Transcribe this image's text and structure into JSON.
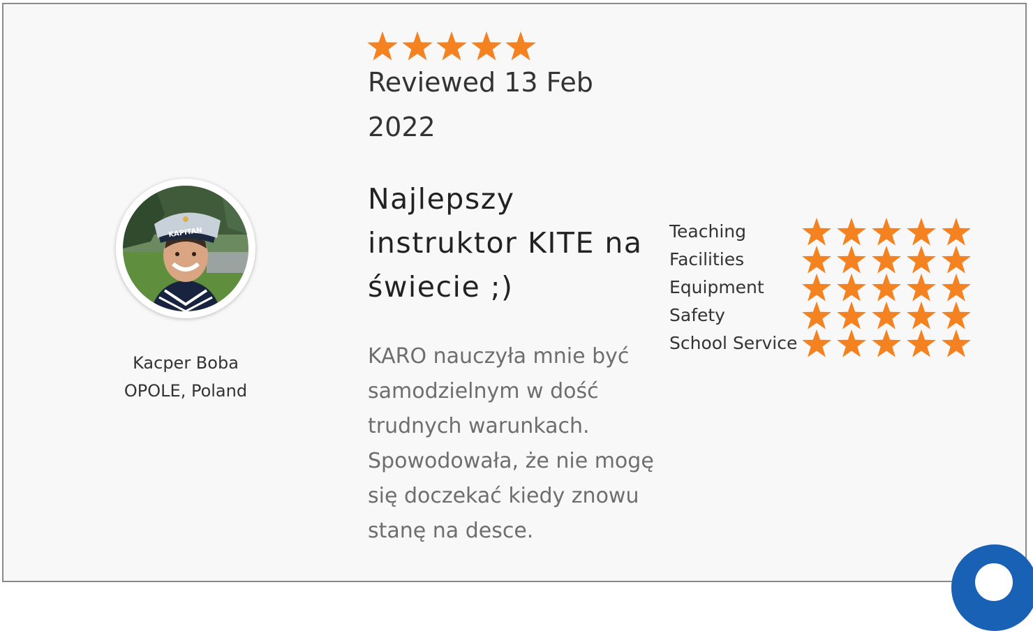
{
  "colors": {
    "star": "#F58220",
    "border": "#8A8A8A",
    "background": "#F8F8F8",
    "help_bubble": "#1961B5"
  },
  "review": {
    "overall_rating": 5,
    "overall_max": 5,
    "reviewed_date": "Reviewed 13 Feb 2022",
    "title": "Najlepszy instruktor KITE na świecie ;)",
    "body": "KARO nauczyła mnie być samodzielnym w dość trudnych warunkach. Spowodowała, że nie mogę się doczekać kiedy znowu stanę na desce."
  },
  "reviewer": {
    "name": "Kacper Boba",
    "location": "OPOLE, Poland",
    "cap_text": "KAPITAN"
  },
  "ratings": [
    {
      "label": "Teaching",
      "value": 5
    },
    {
      "label": "Facilities",
      "value": 5
    },
    {
      "label": "Equipment",
      "value": 5
    },
    {
      "label": "Safety",
      "value": 5
    },
    {
      "label": "School Service",
      "value": 5
    }
  ],
  "icons": {
    "star": "star-icon",
    "help": "chat-bubble-icon"
  }
}
